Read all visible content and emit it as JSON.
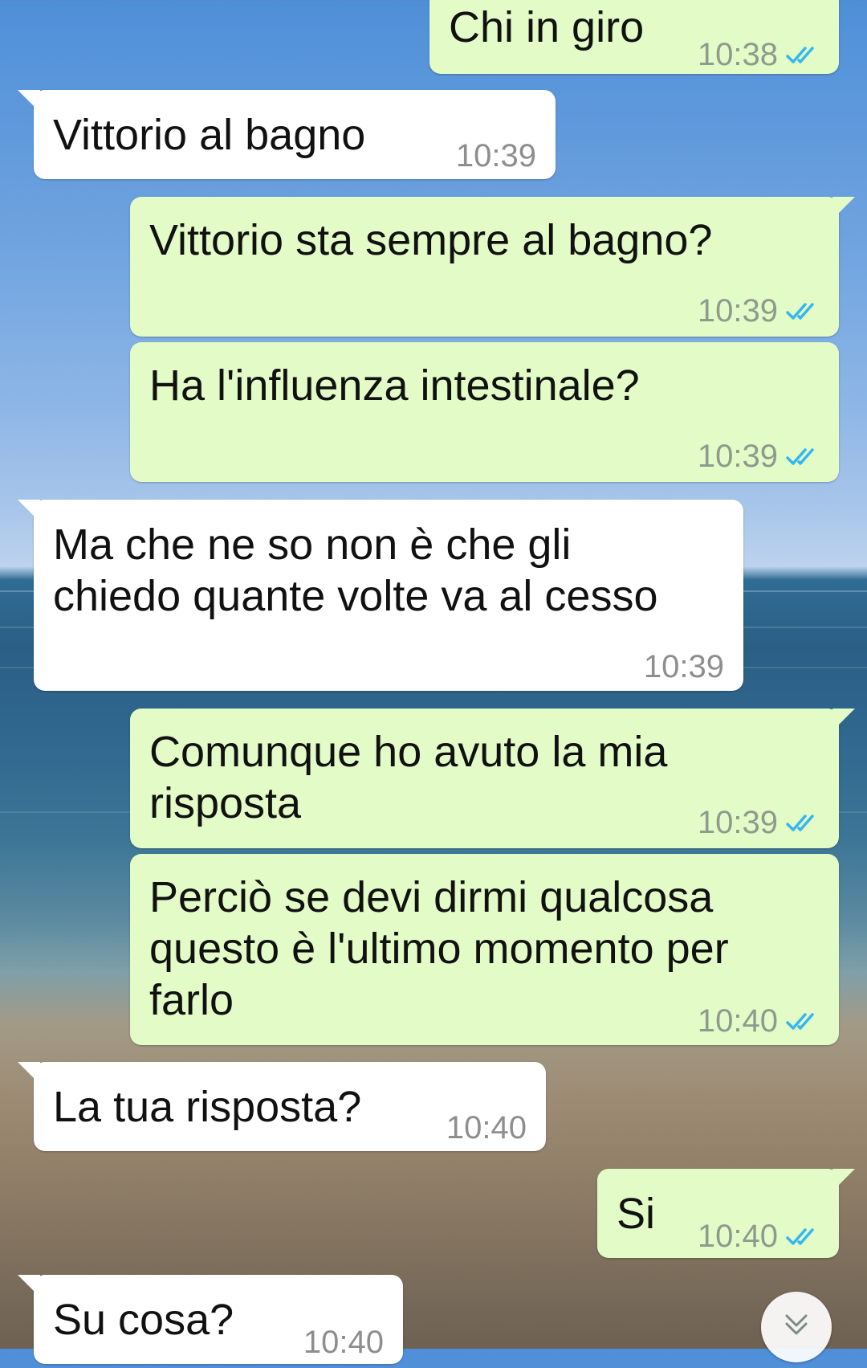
{
  "messages": [
    {
      "dir": "out",
      "text": "Chi in giro",
      "time": "10:38",
      "status": "read"
    },
    {
      "dir": "in",
      "text": "Vittorio al bagno",
      "time": "10:39"
    },
    {
      "dir": "out",
      "text": "Vittorio sta sempre al bagno?",
      "time": "10:39",
      "status": "read"
    },
    {
      "dir": "out",
      "text": "Ha l'influenza intestinale?",
      "time": "10:39",
      "status": "read"
    },
    {
      "dir": "in",
      "text": "Ma che ne so non è che gli\nchiedo quante volte va al cesso",
      "time": "10:39"
    },
    {
      "dir": "out",
      "text": "Comunque ho avuto la mia\nrisposta",
      "time": "10:39",
      "status": "read"
    },
    {
      "dir": "out",
      "text": "Perciò se devi dirmi qualcosa\nquesto è l'ultimo momento per\nfarlo",
      "time": "10:40",
      "status": "read"
    },
    {
      "dir": "in",
      "text": "La tua risposta?",
      "time": "10:40"
    },
    {
      "dir": "out",
      "text": "Si",
      "time": "10:40",
      "status": "read"
    },
    {
      "dir": "in",
      "text": "Su cosa?",
      "time": "10:40"
    }
  ],
  "colors": {
    "outgoing": "#e3fbc6",
    "incoming": "#ffffff",
    "check": "#34b7f1"
  },
  "icons": {
    "read": "double-check-icon",
    "scroll": "chevron-down-icon"
  }
}
